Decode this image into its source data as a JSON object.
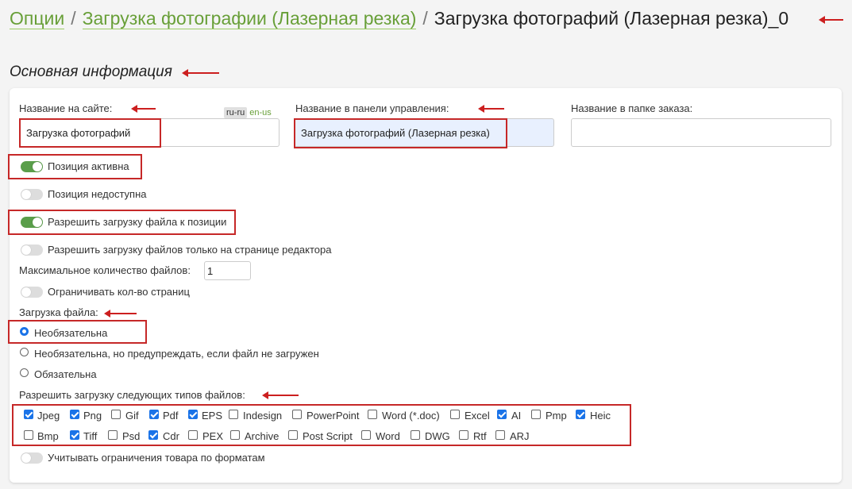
{
  "breadcrumb": {
    "options": "Опции",
    "parent": "Загрузка фотографии (Лазерная резка)",
    "separator": "/",
    "current": "Загрузка фотографий (Лазерная резка)_0"
  },
  "section_title": "Основная информация",
  "fields": {
    "site_name_label": "Название на сайте:",
    "site_name_value": "Загрузка фотографий",
    "lang_ru": "ru-ru",
    "lang_en": "en-us",
    "panel_name_label": "Название в панели управления:",
    "panel_name_value": "Загрузка фотографий (Лазерная резка)",
    "folder_name_label": "Название в папке заказа:",
    "folder_name_value": ""
  },
  "toggles": {
    "active": {
      "label": "Позиция активна",
      "on": true
    },
    "unavailable": {
      "label": "Позиция недоступна",
      "on": false
    },
    "allow_upload": {
      "label": "Разрешить загрузку файла к позиции",
      "on": true
    },
    "editor_only": {
      "label": "Разрешить загрузку файлов только на странице редактора",
      "on": false
    },
    "limit_pages": {
      "label": "Ограничивать кол-во страниц",
      "on": false
    },
    "product_limits": {
      "label": "Учитывать ограничения товара по форматам",
      "on": false
    }
  },
  "max_files": {
    "label": "Максимальное количество файлов:",
    "value": "1"
  },
  "upload": {
    "label": "Загрузка файла:",
    "options": [
      {
        "label": "Необязательна",
        "selected": true
      },
      {
        "label": "Необязательна, но предупреждать, если файл не загружен",
        "selected": false
      },
      {
        "label": "Обязательна",
        "selected": false
      }
    ]
  },
  "file_types": {
    "label": "Разрешить загрузку следующих типов файлов:",
    "row1": [
      {
        "label": "Jpeg",
        "checked": true
      },
      {
        "label": "Png",
        "checked": true
      },
      {
        "label": "Gif",
        "checked": false
      },
      {
        "label": "Pdf",
        "checked": true
      },
      {
        "label": "EPS",
        "checked": true
      },
      {
        "label": "Indesign",
        "checked": false
      },
      {
        "label": "PowerPoint",
        "checked": false
      },
      {
        "label": "Word (*.doc)",
        "checked": false
      },
      {
        "label": "Excel",
        "checked": false
      },
      {
        "label": "AI",
        "checked": true
      },
      {
        "label": "Pmp",
        "checked": false
      },
      {
        "label": "Heic",
        "checked": true
      }
    ],
    "row2": [
      {
        "label": "Bmp",
        "checked": false
      },
      {
        "label": "Tiff",
        "checked": true
      },
      {
        "label": "Psd",
        "checked": false
      },
      {
        "label": "Cdr",
        "checked": true
      },
      {
        "label": "PEX",
        "checked": false
      },
      {
        "label": "Archive",
        "checked": false
      },
      {
        "label": "Post Script",
        "checked": false
      },
      {
        "label": "Word",
        "checked": false
      },
      {
        "label": "DWG",
        "checked": false
      },
      {
        "label": "Rtf",
        "checked": false
      },
      {
        "label": "ARJ",
        "checked": false
      }
    ]
  },
  "colors": {
    "accent_green": "#689f38",
    "toggle_green": "#5a9e4a",
    "annotation_red": "#cc1f1f",
    "check_blue": "#1a73e8"
  }
}
